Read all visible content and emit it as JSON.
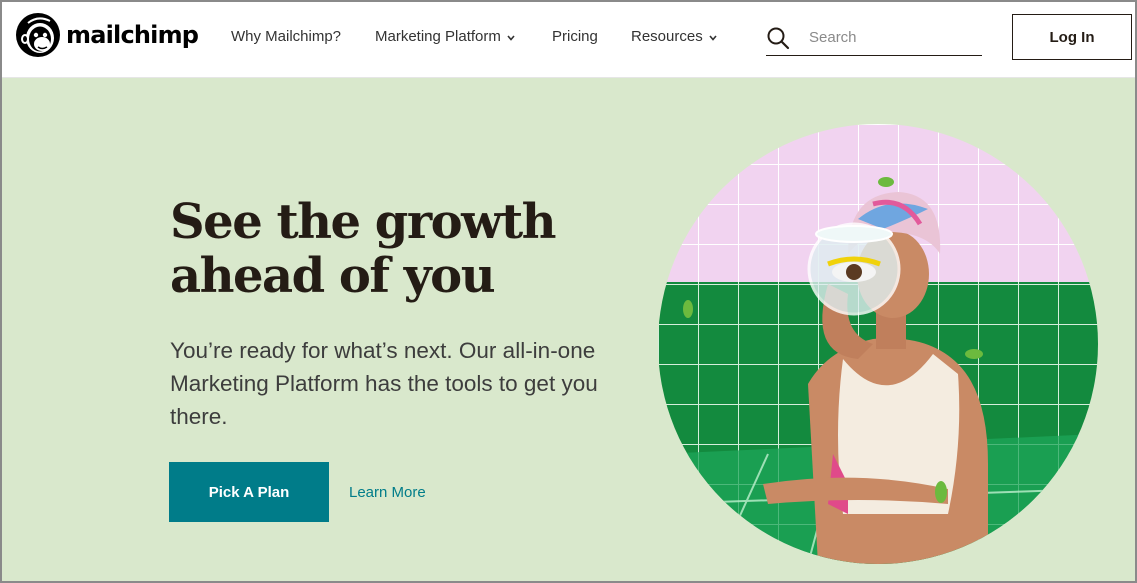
{
  "brand": {
    "name": "mailchimp",
    "logo_icon": "freddie-monkey-icon"
  },
  "nav": {
    "items": [
      {
        "label": "Why Mailchimp?",
        "has_dropdown": false
      },
      {
        "label": "Marketing Platform",
        "has_dropdown": true
      },
      {
        "label": "Pricing",
        "has_dropdown": false
      },
      {
        "label": "Resources",
        "has_dropdown": true
      }
    ],
    "chevron": "⌄"
  },
  "search": {
    "placeholder": "Search",
    "icon": "search-icon"
  },
  "login": {
    "label": "Log In"
  },
  "hero": {
    "headline_line1": "See the growth",
    "headline_line2": "ahead of you",
    "subtext": "You’re ready for what’s next. Our all-in-one Marketing Platform has the tools to get you there.",
    "primary_cta": "Pick A Plan",
    "secondary_cta": "Learn More",
    "image": "woman-with-fishbowl-photo"
  },
  "colors": {
    "hero_bg": "#d9e8cc",
    "accent": "#007c89",
    "text": "#241c15"
  }
}
